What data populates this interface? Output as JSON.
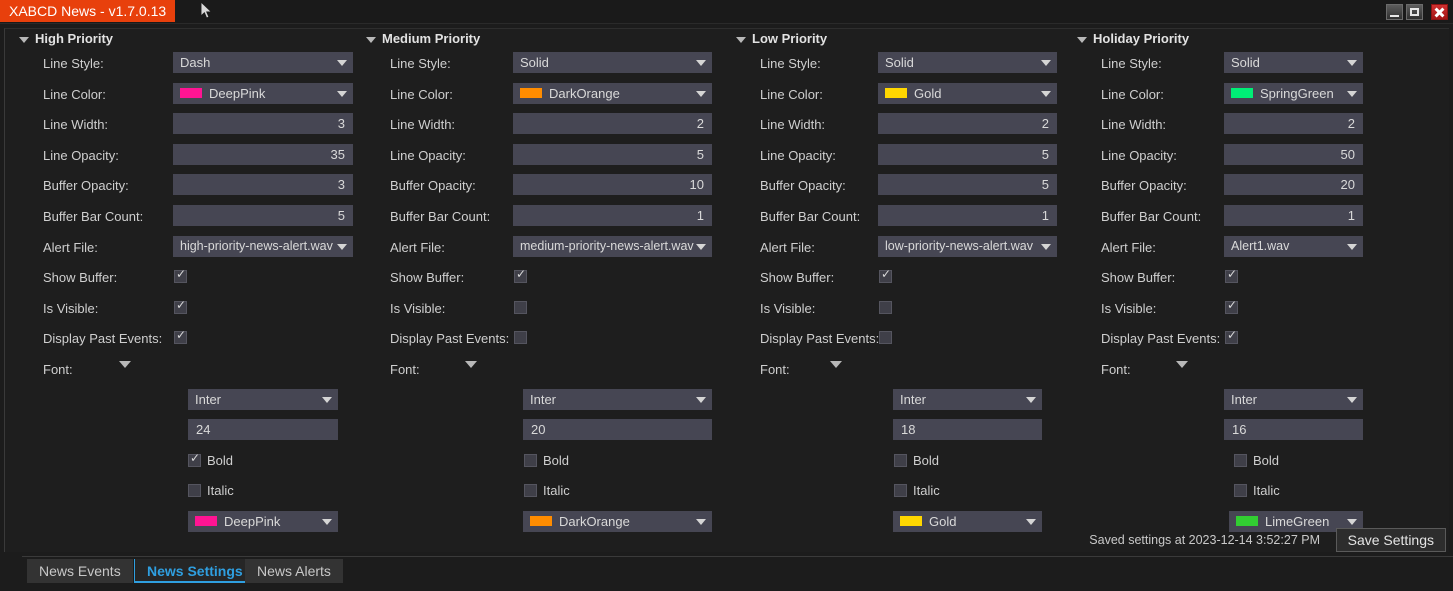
{
  "window": {
    "title": "XABCD News - v1.7.0.13",
    "minimize_icon": "minimize-icon",
    "maximize_icon": "maximize-icon",
    "close_icon": "close-icon"
  },
  "labels": {
    "line_style": "Line Style:",
    "line_color": "Line Color:",
    "line_width": "Line Width:",
    "line_opacity": "Line Opacity:",
    "buffer_opacity": "Buffer Opacity:",
    "buffer_bar_count": "Buffer Bar Count:",
    "alert_file": "Alert File:",
    "show_buffer": "Show Buffer:",
    "is_visible": "Is Visible:",
    "display_past_events": "Display Past Events:",
    "font": "Font:",
    "bold": "Bold",
    "italic": "Italic"
  },
  "colors": {
    "DeepPink": "#ff1493",
    "DarkOrange": "#ff8c00",
    "Gold": "#ffd700",
    "SpringGreen": "#00ee76",
    "LimeGreen": "#32cd32",
    "accent_blue": "#2f9fe0",
    "title_badge": "#e8400c"
  },
  "groups": [
    {
      "title": "High Priority",
      "line_style": "Dash",
      "line_color": "DeepPink",
      "line_color_hex": "#ff1493",
      "line_width": "3",
      "line_opacity": "35",
      "buffer_opacity": "3",
      "buffer_bar_count": "5",
      "alert_file": "high-priority-news-alert.wav",
      "show_buffer": true,
      "is_visible": true,
      "display_past_events": true,
      "font_family": "Inter",
      "font_size": "24",
      "bold": true,
      "italic": false,
      "font_color": "DeepPink",
      "font_color_hex": "#ff1493"
    },
    {
      "title": "Medium Priority",
      "line_style": "Solid",
      "line_color": "DarkOrange",
      "line_color_hex": "#ff8c00",
      "line_width": "2",
      "line_opacity": "5",
      "buffer_opacity": "10",
      "buffer_bar_count": "1",
      "alert_file": "medium-priority-news-alert.wav",
      "show_buffer": true,
      "is_visible": false,
      "display_past_events": false,
      "font_family": "Inter",
      "font_size": "20",
      "bold": false,
      "italic": false,
      "font_color": "DarkOrange",
      "font_color_hex": "#ff8c00"
    },
    {
      "title": "Low Priority",
      "line_style": "Solid",
      "line_color": "Gold",
      "line_color_hex": "#ffd700",
      "line_width": "2",
      "line_opacity": "5",
      "buffer_opacity": "5",
      "buffer_bar_count": "1",
      "alert_file": "low-priority-news-alert.wav",
      "show_buffer": true,
      "is_visible": false,
      "display_past_events": false,
      "font_family": "Inter",
      "font_size": "18",
      "bold": false,
      "italic": false,
      "font_color": "Gold",
      "font_color_hex": "#ffd700"
    },
    {
      "title": "Holiday Priority",
      "line_style": "Solid",
      "line_color": "SpringGreen",
      "line_color_hex": "#00ee76",
      "line_width": "2",
      "line_opacity": "50",
      "buffer_opacity": "20",
      "buffer_bar_count": "1",
      "alert_file": "Alert1.wav",
      "show_buffer": true,
      "is_visible": true,
      "display_past_events": true,
      "font_family": "Inter",
      "font_size": "16",
      "bold": false,
      "italic": false,
      "font_color": "LimeGreen",
      "font_color_hex": "#32cd32"
    }
  ],
  "footer": {
    "saved_message": "Saved settings at 2023-12-14 3:52:27 PM",
    "save_button": "Save Settings"
  },
  "tabs": [
    {
      "label": "News Events",
      "active": false
    },
    {
      "label": "News Settings",
      "active": true
    },
    {
      "label": "News Alerts",
      "active": false
    }
  ]
}
